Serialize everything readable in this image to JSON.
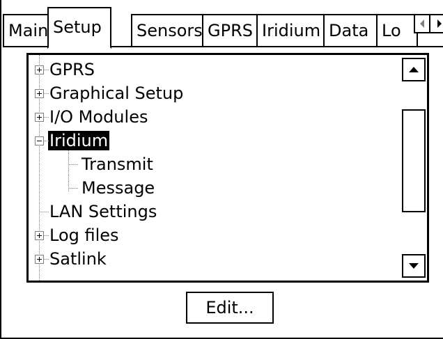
{
  "tabs": [
    {
      "label": "Main",
      "active": false
    },
    {
      "label": "Setup",
      "active": true
    },
    {
      "label": "Sensors",
      "active": false
    },
    {
      "label": "GPRS",
      "active": false
    },
    {
      "label": "Iridium",
      "active": false
    },
    {
      "label": "Data",
      "active": false
    },
    {
      "label": "Lo",
      "active": false
    }
  ],
  "tab_scroll": {
    "left_icon": "triangle-left-icon",
    "right_icon": "triangle-right-icon"
  },
  "tree": {
    "items": [
      {
        "label": "GPRS",
        "expander": "plus",
        "level": 0
      },
      {
        "label": "Graphical Setup",
        "expander": "plus",
        "level": 0
      },
      {
        "label": "I/O Modules",
        "expander": "plus",
        "level": 0
      },
      {
        "label": "Iridium",
        "expander": "minus",
        "level": 0,
        "selected": true
      },
      {
        "label": "Transmit",
        "expander": "none",
        "level": 1
      },
      {
        "label": "Message",
        "expander": "none",
        "level": 1
      },
      {
        "label": "LAN Settings",
        "expander": "none",
        "level": 0
      },
      {
        "label": "Log files",
        "expander": "plus",
        "level": 0
      },
      {
        "label": "Satlink",
        "expander": "plus",
        "level": 0
      }
    ]
  },
  "scrollbar": {
    "up_icon": "triangle-up-icon",
    "down_icon": "triangle-down-icon"
  },
  "edit_button": {
    "label": "Edit..."
  }
}
